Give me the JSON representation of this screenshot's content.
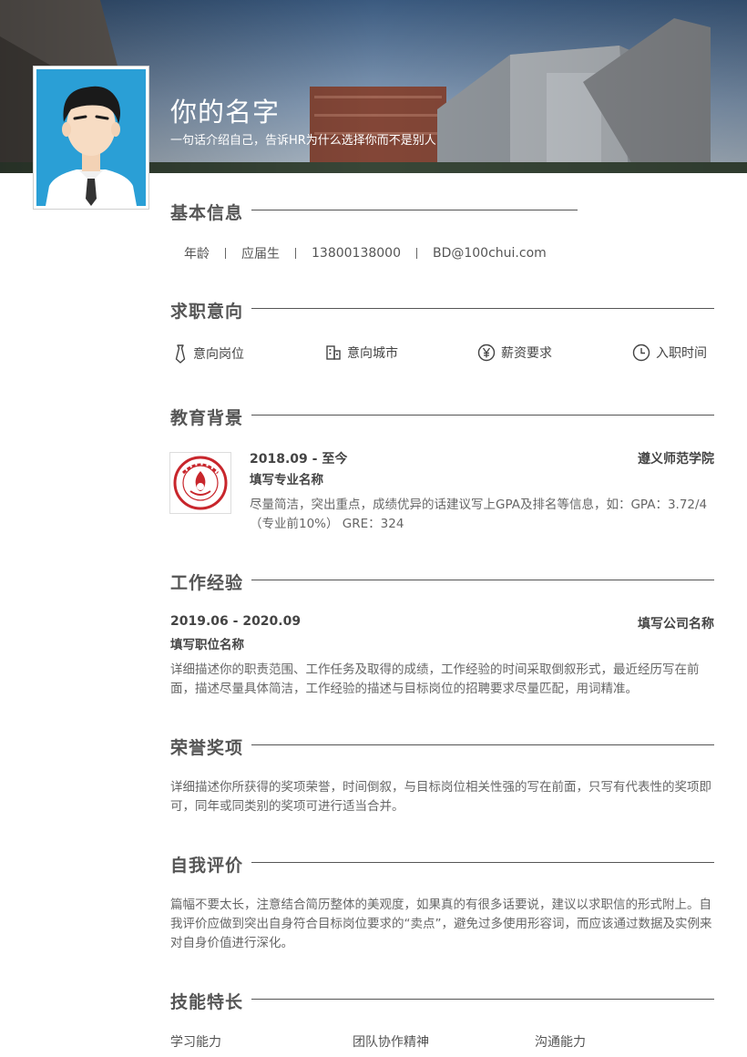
{
  "header": {
    "name": "你的名字",
    "tagline": "一句话介绍自己，告诉HR为什么选择你而不是别人"
  },
  "basic_info": {
    "title": "基本信息",
    "items": [
      "年龄",
      "应届生",
      "13800138000",
      "BD@100chui.com"
    ]
  },
  "job_intent": {
    "title": "求职意向",
    "items": [
      {
        "icon": "tie-icon",
        "label": "意向岗位"
      },
      {
        "icon": "building-icon",
        "label": "意向城市"
      },
      {
        "icon": "yen-icon",
        "label": "薪资要求"
      },
      {
        "icon": "clock-icon",
        "label": "入职时间"
      }
    ]
  },
  "education": {
    "title": "教育背景",
    "period": "2018.09 - 至今",
    "school": "遵义师范学院",
    "major": "填写专业名称",
    "description": "尽量简洁，突出重点，成绩优异的话建议写上GPA及排名等信息，如：GPA：3.72/4（专业前10%） GRE：324",
    "logo_icon": "school-seal-icon"
  },
  "work": {
    "title": "工作经验",
    "period": "2019.06 - 2020.09",
    "company": "填写公司名称",
    "position": "填写职位名称",
    "description": "详细描述你的职责范围、工作任务及取得的成绩，工作经验的时间采取倒叙形式，最近经历写在前面，描述尽量具体简洁，工作经验的描述与目标岗位的招聘要求尽量匹配，用词精准。"
  },
  "honors": {
    "title": "荣誉奖项",
    "description": "详细描述你所获得的奖项荣誉，时间倒叙，与目标岗位相关性强的写在前面，只写有代表性的奖项即可，同年或同类别的奖项可进行适当合并。"
  },
  "self_eval": {
    "title": "自我评价",
    "description": "篇幅不要太长，注意结合简历整体的美观度，如果真的有很多话要说，建议以求职信的形式附上。自我评价应做到突出自身符合目标岗位要求的“卖点”，避免过多使用形容词，而应该通过数据及实例来对自身价值进行深化。"
  },
  "skills": {
    "title": "技能特长",
    "items": [
      "学习能力",
      "团队协作精神",
      "沟通能力"
    ]
  },
  "colors": {
    "accent": "#555555",
    "logo_red": "#c8262c"
  }
}
